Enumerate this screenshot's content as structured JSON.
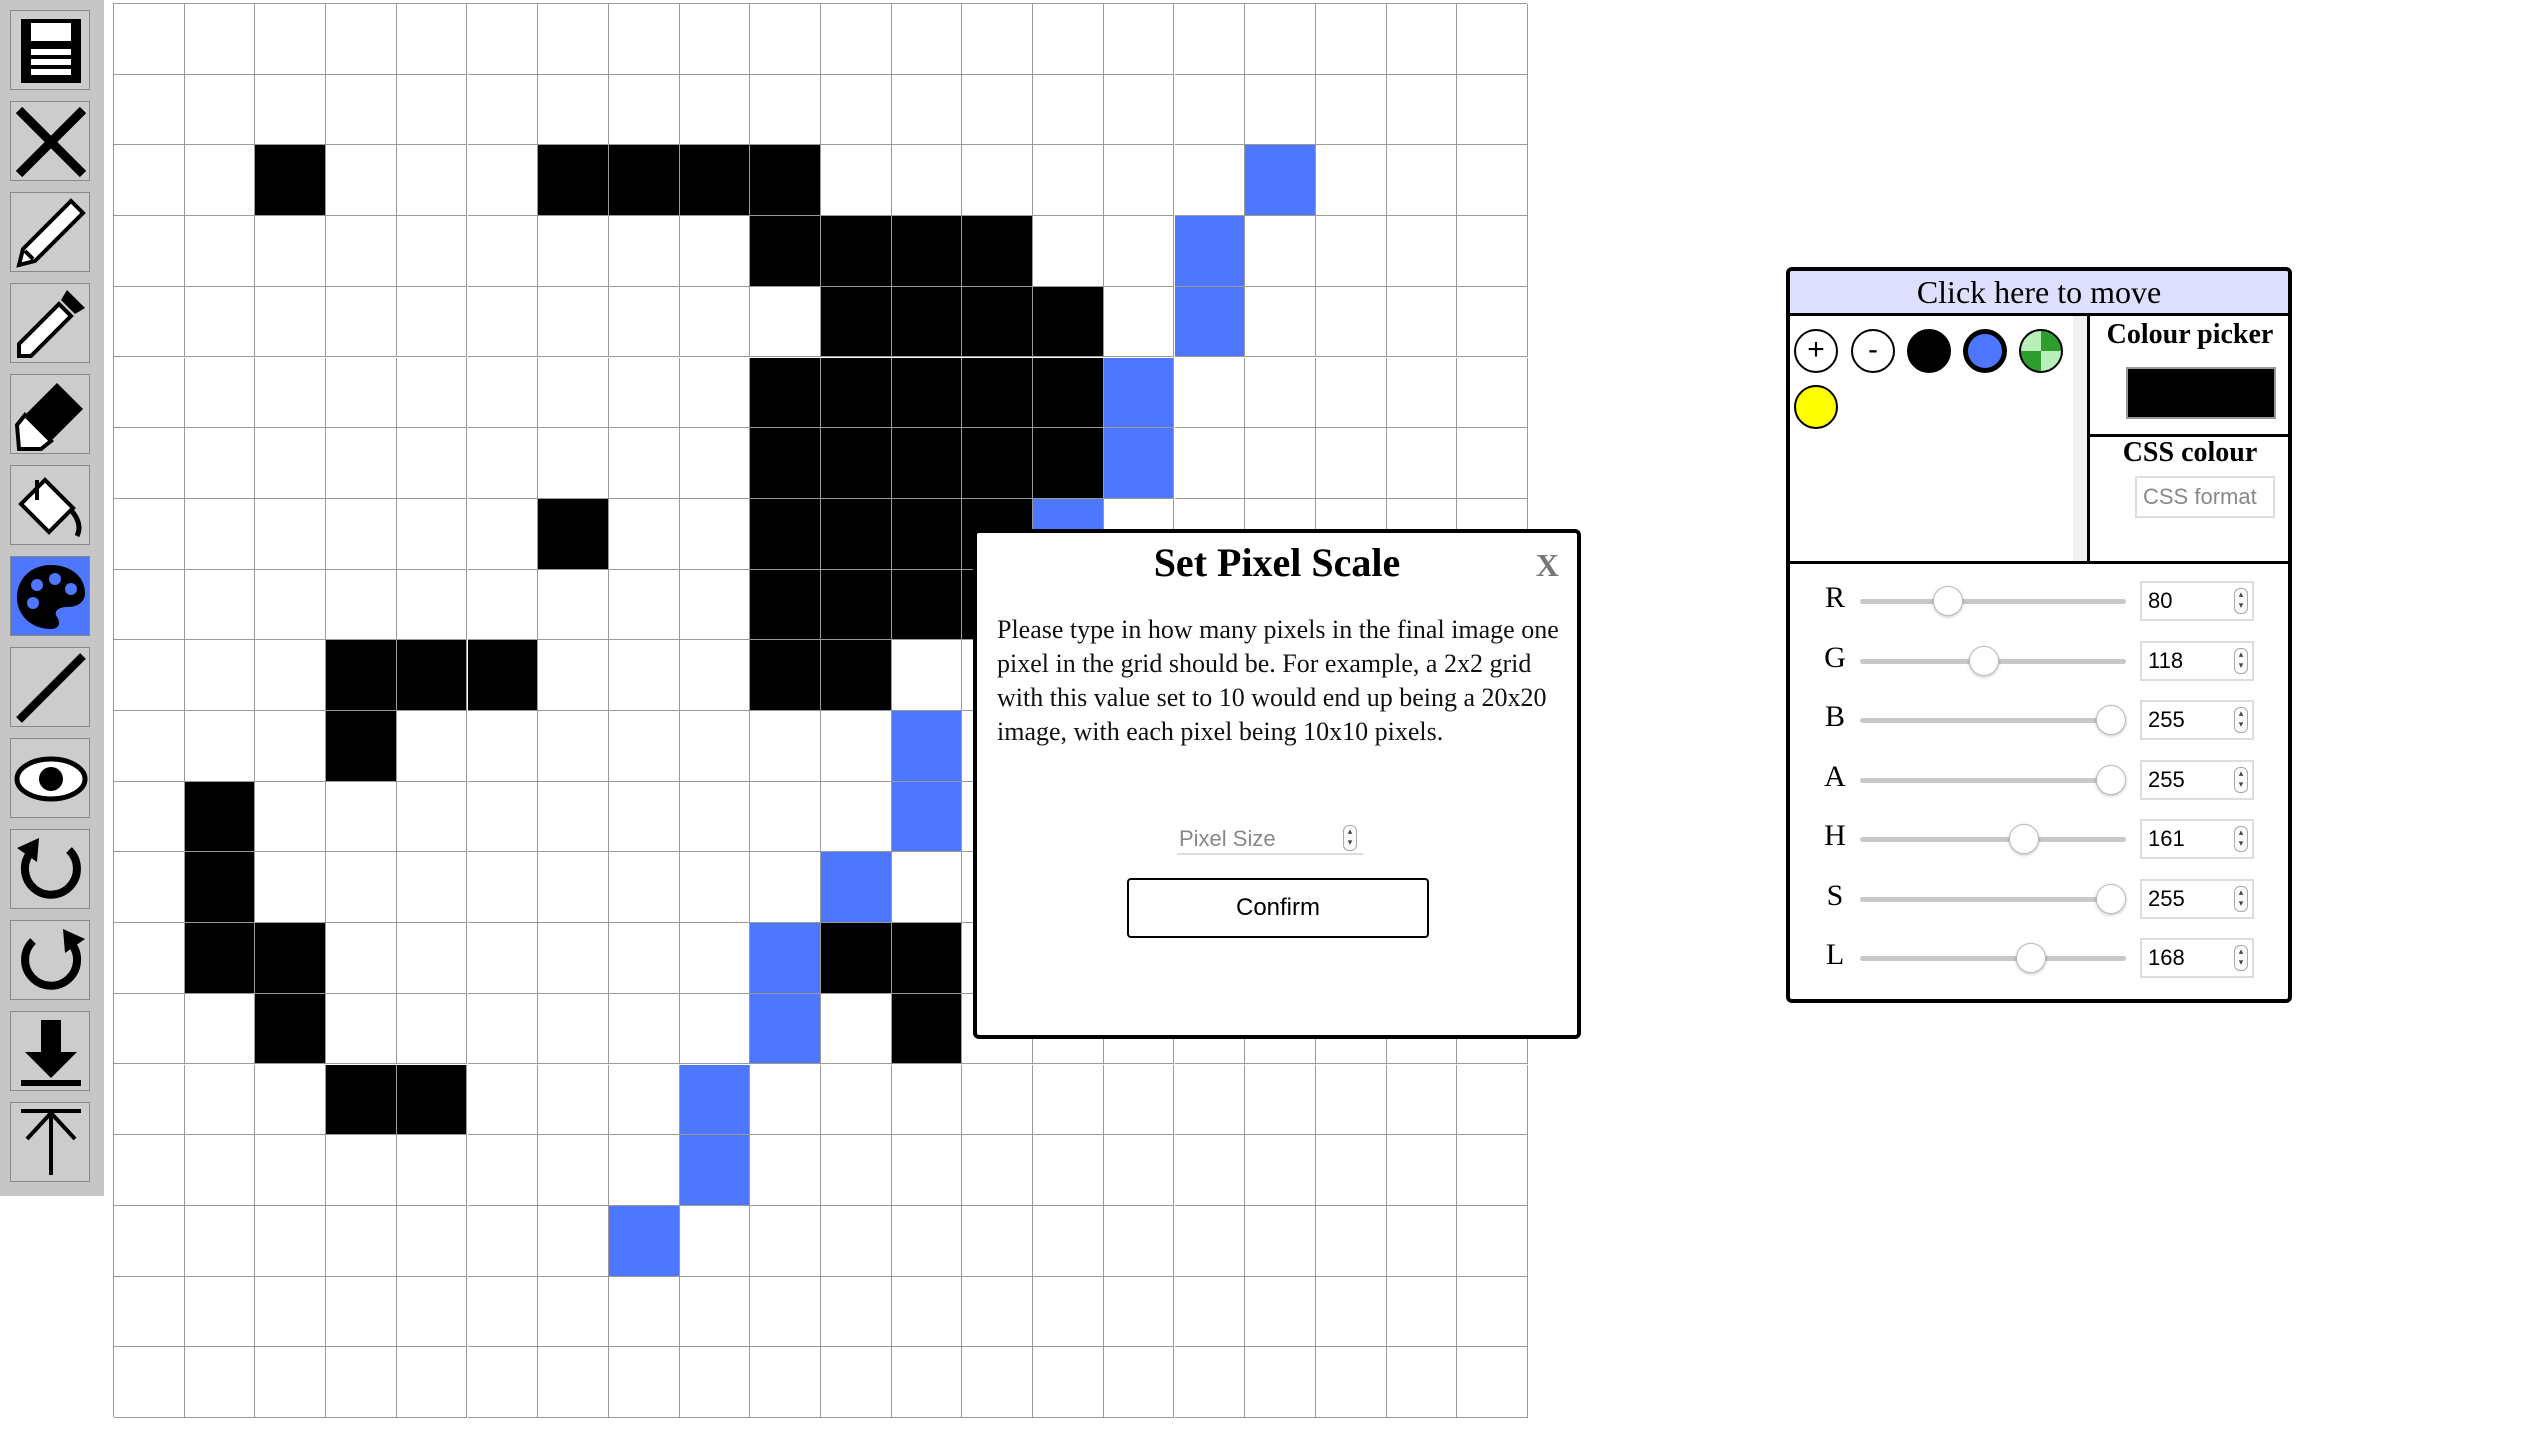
{
  "colors": {
    "black": "#000000",
    "blue": "#4f76ff",
    "yellow": "#ffff00",
    "green": "#67c467",
    "toolbar_bg": "#c6c6c6",
    "panel_header_bg": "#dfe0ff"
  },
  "toolbar": {
    "tools": [
      {
        "name": "save-icon",
        "active": false
      },
      {
        "name": "clear-icon",
        "active": false
      },
      {
        "name": "pencil-icon",
        "active": false
      },
      {
        "name": "eyedropper-icon",
        "active": false
      },
      {
        "name": "eraser-icon",
        "active": false
      },
      {
        "name": "fill-bucket-icon",
        "active": false
      },
      {
        "name": "palette-icon",
        "active": true
      },
      {
        "name": "line-icon",
        "active": false
      },
      {
        "name": "eye-icon",
        "active": false
      },
      {
        "name": "undo-icon",
        "active": false
      },
      {
        "name": "redo-icon",
        "active": false
      },
      {
        "name": "download-icon",
        "active": false
      },
      {
        "name": "upload-icon",
        "active": false
      }
    ]
  },
  "grid": {
    "rows": 20,
    "cols": 20,
    "black_cells": [
      [
        2,
        2
      ],
      [
        2,
        6
      ],
      [
        2,
        7
      ],
      [
        2,
        8
      ],
      [
        2,
        9
      ],
      [
        3,
        9
      ],
      [
        3,
        10
      ],
      [
        3,
        11
      ],
      [
        3,
        12
      ],
      [
        4,
        10
      ],
      [
        4,
        11
      ],
      [
        4,
        12
      ],
      [
        4,
        13
      ],
      [
        5,
        9
      ],
      [
        5,
        10
      ],
      [
        5,
        11
      ],
      [
        5,
        12
      ],
      [
        5,
        13
      ],
      [
        6,
        9
      ],
      [
        6,
        10
      ],
      [
        6,
        11
      ],
      [
        6,
        12
      ],
      [
        6,
        13
      ],
      [
        7,
        6
      ],
      [
        7,
        9
      ],
      [
        7,
        10
      ],
      [
        7,
        11
      ],
      [
        7,
        12
      ],
      [
        8,
        9
      ],
      [
        8,
        10
      ],
      [
        8,
        11
      ],
      [
        8,
        12
      ],
      [
        9,
        3
      ],
      [
        9,
        4
      ],
      [
        9,
        5
      ],
      [
        9,
        9
      ],
      [
        9,
        10
      ],
      [
        10,
        3
      ],
      [
        11,
        1
      ],
      [
        12,
        1
      ],
      [
        13,
        1
      ],
      [
        13,
        2
      ],
      [
        13,
        10
      ],
      [
        13,
        11
      ],
      [
        14,
        2
      ],
      [
        14,
        11
      ],
      [
        15,
        3
      ],
      [
        15,
        4
      ]
    ],
    "blue_cells": [
      [
        2,
        16
      ],
      [
        3,
        15
      ],
      [
        4,
        15
      ],
      [
        5,
        14
      ],
      [
        6,
        14
      ],
      [
        7,
        13
      ],
      [
        8,
        12
      ],
      [
        10,
        11
      ],
      [
        11,
        11
      ],
      [
        12,
        10
      ],
      [
        13,
        9
      ],
      [
        14,
        9
      ],
      [
        15,
        8
      ],
      [
        16,
        8
      ],
      [
        17,
        7
      ]
    ]
  },
  "dialog": {
    "title": "Set Pixel Scale",
    "close_label": "X",
    "body": "Please type in how many pixels in the final image one pixel in the grid should be. For example, a 2x2 grid with this value set to 10 would end up being a 20x20 image, with each pixel being 10x10 pixels.",
    "input_placeholder": "Pixel Size",
    "confirm_label": "Confirm"
  },
  "panel": {
    "header": "Click here to move",
    "add_label": "+",
    "remove_label": "-",
    "colour_picker_label": "Colour picker",
    "css_colour_label": "CSS colour",
    "css_placeholder": "CSS format",
    "sliders": [
      {
        "label": "R",
        "value": "80",
        "fraction": 0.31
      },
      {
        "label": "G",
        "value": "118",
        "fraction": 0.46
      },
      {
        "label": "B",
        "value": "255",
        "fraction": 1.0
      },
      {
        "label": "A",
        "value": "255",
        "fraction": 1.0
      },
      {
        "label": "H",
        "value": "161",
        "fraction": 0.63
      },
      {
        "label": "S",
        "value": "255",
        "fraction": 1.0
      },
      {
        "label": "L",
        "value": "168",
        "fraction": 0.66
      }
    ]
  }
}
